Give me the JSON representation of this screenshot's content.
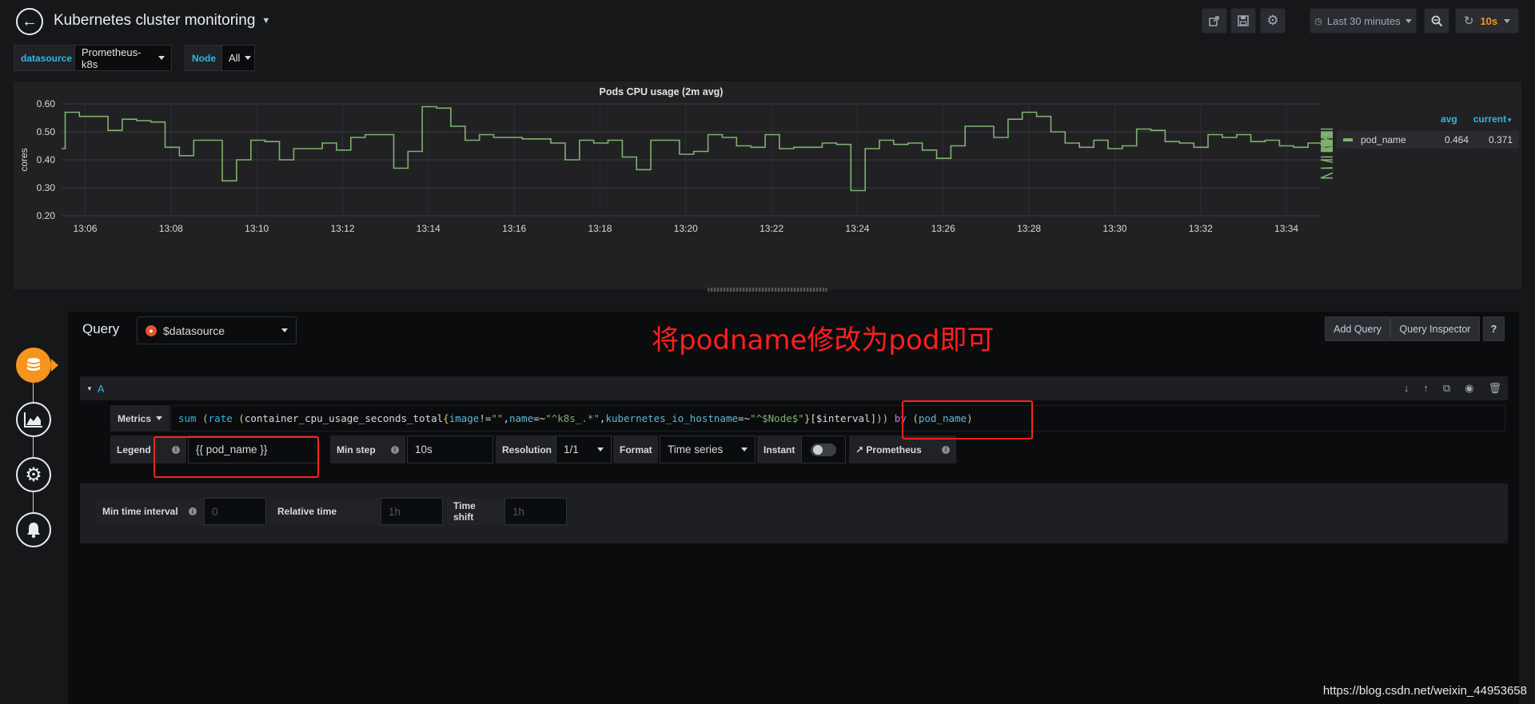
{
  "header": {
    "title": "Kubernetes cluster monitoring",
    "time_range": "Last 30 minutes",
    "refresh": "10s"
  },
  "variables": [
    {
      "label": "datasource",
      "value": "Prometheus-k8s"
    },
    {
      "label": "Node",
      "value": "All"
    }
  ],
  "panel": {
    "title": "Pods CPU usage (2m avg)",
    "legend_headers": [
      "avg",
      "current"
    ],
    "legend": [
      {
        "name": "pod_name",
        "avg": "0.464",
        "current": "0.371"
      }
    ]
  },
  "chart_data": {
    "type": "line",
    "title": "Pods CPU usage (2m avg)",
    "ylabel": "cores",
    "xlabel": "",
    "ylim": [
      0.2,
      0.6
    ],
    "yticks": [
      "0.60",
      "0.50",
      "0.40",
      "0.30",
      "0.20"
    ],
    "xticks": [
      "13:06",
      "13:08",
      "13:10",
      "13:12",
      "13:14",
      "13:16",
      "13:18",
      "13:20",
      "13:22",
      "13:24",
      "13:26",
      "13:28",
      "13:30",
      "13:32",
      "13:34"
    ],
    "series": [
      {
        "name": "pod_name",
        "color": "#7eb26d",
        "x_minutes_start": 5.2,
        "step_minutes": 0.333,
        "values": [
          0.44,
          0.57,
          0.555,
          0.555,
          0.505,
          0.545,
          0.54,
          0.535,
          0.445,
          0.415,
          0.47,
          0.47,
          0.325,
          0.4,
          0.47,
          0.465,
          0.4,
          0.44,
          0.44,
          0.46,
          0.435,
          0.48,
          0.49,
          0.49,
          0.37,
          0.43,
          0.59,
          0.585,
          0.52,
          0.47,
          0.49,
          0.48,
          0.48,
          0.475,
          0.475,
          0.46,
          0.4,
          0.47,
          0.46,
          0.47,
          0.41,
          0.365,
          0.47,
          0.47,
          0.42,
          0.43,
          0.49,
          0.48,
          0.45,
          0.445,
          0.49,
          0.44,
          0.445,
          0.445,
          0.46,
          0.455,
          0.29,
          0.44,
          0.47,
          0.455,
          0.46,
          0.435,
          0.405,
          0.45,
          0.52,
          0.52,
          0.48,
          0.545,
          0.57,
          0.555,
          0.5,
          0.46,
          0.445,
          0.47,
          0.44,
          0.45,
          0.51,
          0.505,
          0.465,
          0.46,
          0.445,
          0.49,
          0.48,
          0.49,
          0.465,
          0.47,
          0.45,
          0.445,
          0.46,
          0.44,
          0.47,
          0.47,
          0.46,
          0.48,
          0.4,
          0.335,
          0.49,
          0.49,
          0.45,
          0.44,
          0.495,
          0.455,
          0.49,
          0.48,
          0.46,
          0.47,
          0.45,
          0.455,
          0.45,
          0.47,
          0.46,
          0.435,
          0.465,
          0.495,
          0.495,
          0.43,
          0.47,
          0.47,
          0.37,
          0.43,
          0.485,
          0.48,
          0.41,
          0.43,
          0.51,
          0.5,
          0.37
        ]
      }
    ]
  },
  "editor": {
    "query_label": "Query",
    "datasource": "$datasource",
    "add_query": "Add Query",
    "query_inspector": "Query Inspector",
    "help": "?",
    "ref_id": "A",
    "metrics_label": "Metrics",
    "legend_label": "Legend",
    "legend_value": "{{ pod_name }}",
    "min_step_label": "Min step",
    "min_step_value": "10s",
    "resolution_label": "Resolution",
    "resolution_value": "1/1",
    "format_label": "Format",
    "format_value": "Time series",
    "instant_label": "Instant",
    "prometheus_link": "Prometheus",
    "min_time_interval_label": "Min time interval",
    "min_time_interval_placeholder": "0",
    "relative_time_label": "Relative time",
    "relative_time_placeholder": "1h",
    "time_shift_label": "Time shift",
    "time_shift_placeholder": "1h"
  },
  "query_tokens": [
    {
      "text": "sum",
      "cls": "tk-fn"
    },
    {
      "text": " (",
      "cls": "tk-paren"
    },
    {
      "text": "rate",
      "cls": "tk-fn"
    },
    {
      "text": " (",
      "cls": "tk-paren"
    },
    {
      "text": "container_cpu_usage_seconds_total",
      "cls": "tk-id"
    },
    {
      "text": "{",
      "cls": "tk-paren"
    },
    {
      "text": "image",
      "cls": "tk-lbl"
    },
    {
      "text": "!=",
      "cls": "tk-id"
    },
    {
      "text": "\"\"",
      "cls": "tk-str"
    },
    {
      "text": ",",
      "cls": "tk-id"
    },
    {
      "text": "name",
      "cls": "tk-lbl"
    },
    {
      "text": "=~",
      "cls": "tk-id"
    },
    {
      "text": "\"^k8s_.*\"",
      "cls": "tk-str"
    },
    {
      "text": ",",
      "cls": "tk-id"
    },
    {
      "text": "kubernetes_io_hostname",
      "cls": "tk-lbl"
    },
    {
      "text": "=~",
      "cls": "tk-id"
    },
    {
      "text": "\"^$Node$\"",
      "cls": "tk-str"
    },
    {
      "text": "}",
      "cls": "tk-paren"
    },
    {
      "text": "[$interval]",
      "cls": "tk-id"
    },
    {
      "text": "))",
      "cls": "tk-paren"
    },
    {
      "text": " ",
      "cls": "tk-id"
    },
    {
      "text": "by",
      "cls": "tk-kw"
    },
    {
      "text": " (",
      "cls": "tk-paren"
    },
    {
      "text": "pod_name",
      "cls": "tk-lbl"
    },
    {
      "text": ")",
      "cls": "tk-paren"
    }
  ],
  "annotation": "将podname修改为pod即可",
  "watermark": "https://blog.csdn.net/weixin_44953658"
}
